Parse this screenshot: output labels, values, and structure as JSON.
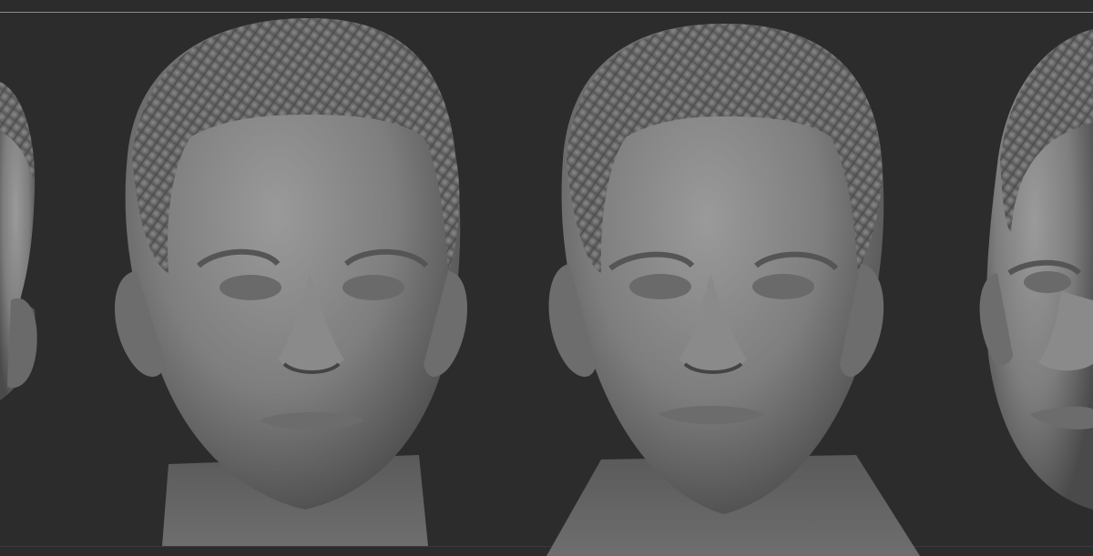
{
  "canvas": {
    "background_color": "#2c2c2c",
    "frame_line_color": "#8a8a8a",
    "sculpt_material_color": "#8d8d8d"
  },
  "models": [
    {
      "name": "head-sculpt-left-partial",
      "view": "three-quarter",
      "visible": "partial"
    },
    {
      "name": "head-sculpt-front-1",
      "view": "front",
      "visible": "full"
    },
    {
      "name": "head-sculpt-front-2",
      "view": "front",
      "visible": "full"
    },
    {
      "name": "head-sculpt-right-partial",
      "view": "three-quarter",
      "visible": "partial"
    }
  ]
}
